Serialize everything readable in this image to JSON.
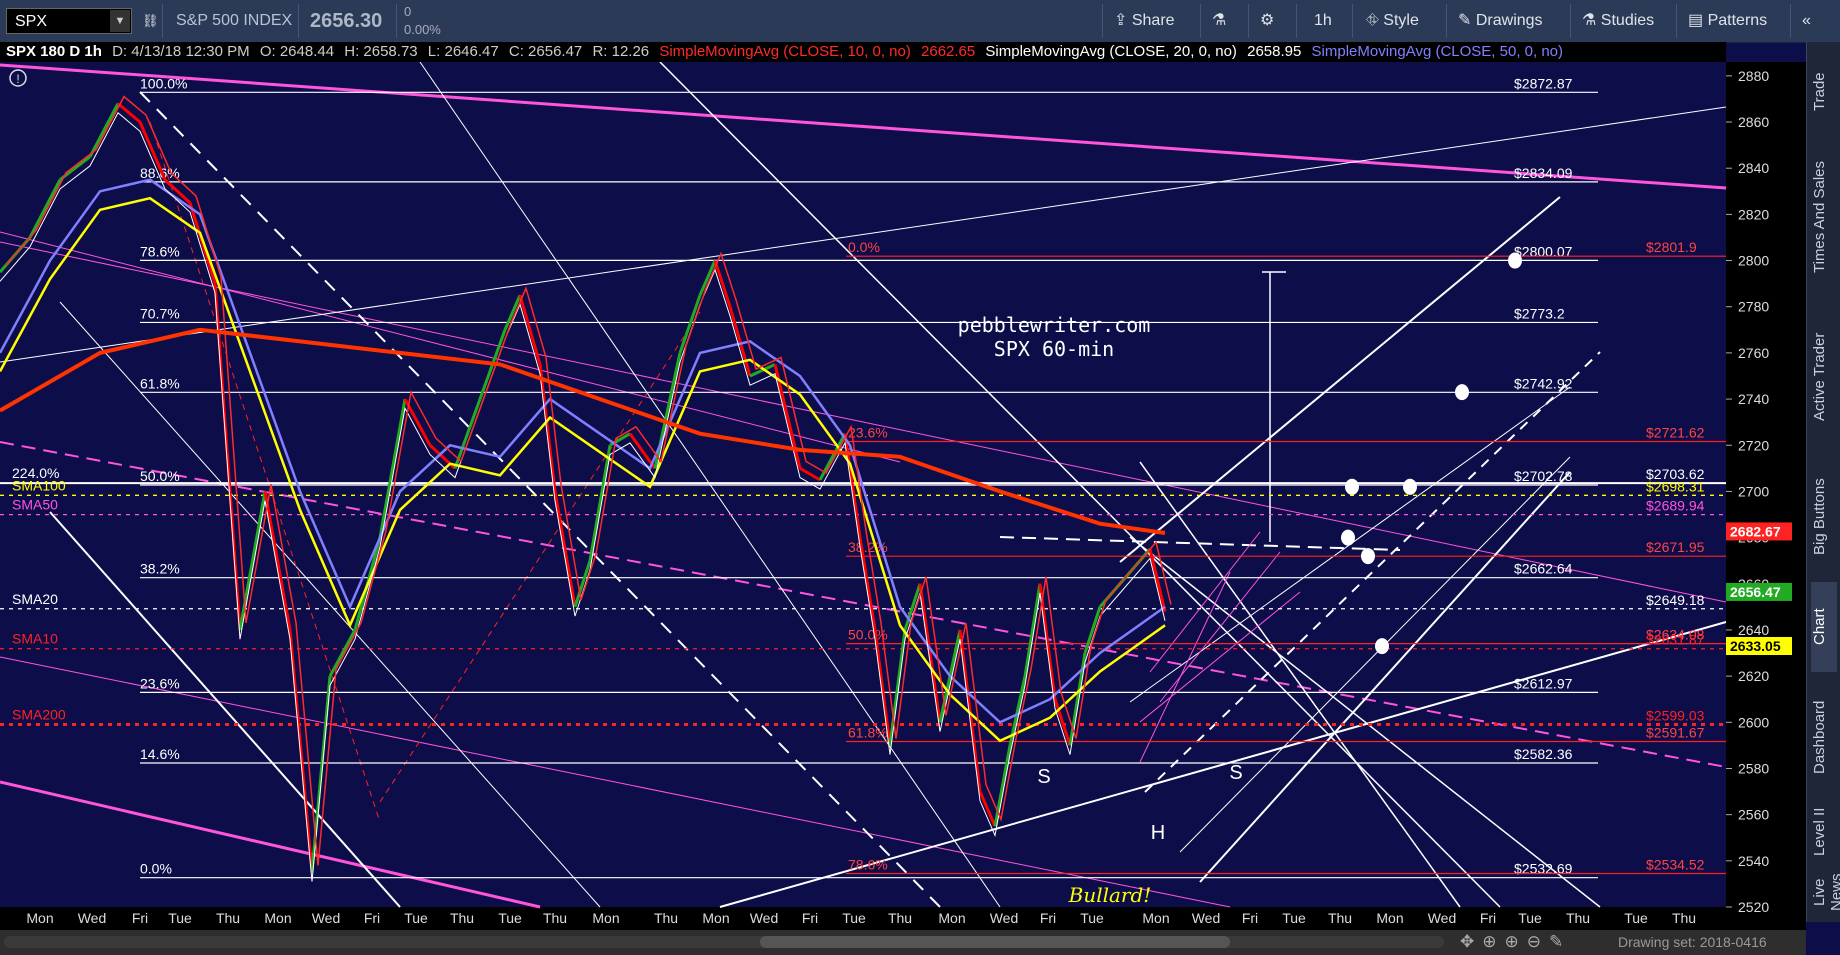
{
  "toolbar": {
    "symbol": "SPX",
    "name": "S&P 500 INDEX",
    "last": "2656.30",
    "change": "0",
    "change_pct": "0.00%",
    "share": "Share",
    "interval": "1h",
    "style": "Style",
    "drawings": "Drawings",
    "studies": "Studies",
    "patterns": "Patterns"
  },
  "infobar": {
    "title": "SPX 180 D 1h",
    "date": "D: 4/13/18 12:30 PM",
    "open": "O: 2648.44",
    "high": "H: 2658.73",
    "low": "L: 2646.47",
    "close": "C: 2656.47",
    "range": "R: 12.26",
    "sma10_label": "SimpleMovingAvg (CLOSE, 10, 0, no)",
    "sma10_val": "2662.65",
    "sma20_label": "SimpleMovingAvg (CLOSE, 20, 0, no)",
    "sma20_val": "2658.95",
    "sma50_label": "SimpleMovingAvg (CLOSE, 50, 0, no)"
  },
  "side_tabs": [
    "Trade",
    "Times And Sales",
    "Active Trader",
    "Big Buttons",
    "Chart",
    "Dashboard",
    "Level II",
    "Live News"
  ],
  "bottombar": {
    "drawing_set": "Drawing set: 2018-0416"
  },
  "colors": {
    "background": "#0d0d4a",
    "sma10": "#ff2a2a",
    "sma20": "#ffffff",
    "sma50": "#8080ff",
    "sma100": "#ffff00",
    "sma200": "#ff3300",
    "magenta": "#ff55dd",
    "fib": "#ffffff",
    "red_level": "#ff2222",
    "price_green": "#22aa22",
    "price_red": "#ff0000"
  },
  "chart_data": {
    "type": "line",
    "ylim": [
      2520,
      2886
    ],
    "yticks": [
      2520,
      2540,
      2560,
      2580,
      2600,
      2620,
      2640,
      2660,
      2680,
      2700,
      2720,
      2740,
      2760,
      2780,
      2800,
      2820,
      2840,
      2860,
      2880
    ],
    "xtick_labels": [
      "Mon",
      "Wed",
      "Fri",
      "Tue",
      "Thu",
      "Mon",
      "Wed",
      "Fri",
      "Tue",
      "Thu",
      "Tue",
      "Thu",
      "Mon",
      "Thu",
      "Mon",
      "Wed",
      "Fri",
      "Tue",
      "Thu",
      "Mon",
      "Wed",
      "Fri",
      "Tue",
      "Mon",
      "Wed",
      "Fri",
      "Tue",
      "Thu",
      "Mon",
      "Wed",
      "Fri",
      "Tue",
      "Thu",
      "Tue",
      "Thu"
    ],
    "price_path": [
      [
        0,
        2795
      ],
      [
        30,
        2810
      ],
      [
        60,
        2835
      ],
      [
        90,
        2845
      ],
      [
        118,
        2868
      ],
      [
        140,
        2860
      ],
      [
        165,
        2835
      ],
      [
        190,
        2825
      ],
      [
        215,
        2790
      ],
      [
        240,
        2640
      ],
      [
        265,
        2700
      ],
      [
        290,
        2640
      ],
      [
        312,
        2535
      ],
      [
        330,
        2620
      ],
      [
        355,
        2640
      ],
      [
        380,
        2680
      ],
      [
        405,
        2740
      ],
      [
        430,
        2720
      ],
      [
        455,
        2710
      ],
      [
        480,
        2740
      ],
      [
        505,
        2770
      ],
      [
        520,
        2785
      ],
      [
        540,
        2755
      ],
      [
        555,
        2700
      ],
      [
        575,
        2650
      ],
      [
        590,
        2670
      ],
      [
        610,
        2720
      ],
      [
        630,
        2725
      ],
      [
        655,
        2710
      ],
      [
        680,
        2760
      ],
      [
        700,
        2785
      ],
      [
        715,
        2800
      ],
      [
        730,
        2780
      ],
      [
        750,
        2750
      ],
      [
        775,
        2755
      ],
      [
        800,
        2710
      ],
      [
        820,
        2705
      ],
      [
        845,
        2725
      ],
      [
        860,
        2680
      ],
      [
        875,
        2640
      ],
      [
        890,
        2590
      ],
      [
        905,
        2640
      ],
      [
        920,
        2660
      ],
      [
        940,
        2600
      ],
      [
        960,
        2640
      ],
      [
        980,
        2570
      ],
      [
        995,
        2555
      ],
      [
        1010,
        2590
      ],
      [
        1025,
        2620
      ],
      [
        1040,
        2660
      ],
      [
        1055,
        2610
      ],
      [
        1070,
        2590
      ],
      [
        1085,
        2630
      ],
      [
        1100,
        2650
      ],
      [
        1120,
        2660
      ],
      [
        1140,
        2670
      ],
      [
        1150,
        2675
      ],
      [
        1165,
        2648
      ]
    ],
    "sma_path": [
      [
        0,
        2760
      ],
      [
        50,
        2800
      ],
      [
        100,
        2830
      ],
      [
        150,
        2835
      ],
      [
        200,
        2820
      ],
      [
        250,
        2760
      ],
      [
        300,
        2700
      ],
      [
        350,
        2650
      ],
      [
        400,
        2700
      ],
      [
        450,
        2720
      ],
      [
        500,
        2715
      ],
      [
        550,
        2740
      ],
      [
        600,
        2725
      ],
      [
        650,
        2710
      ],
      [
        700,
        2760
      ],
      [
        750,
        2765
      ],
      [
        800,
        2750
      ],
      [
        850,
        2720
      ],
      [
        900,
        2650
      ],
      [
        950,
        2620
      ],
      [
        1000,
        2600
      ],
      [
        1050,
        2610
      ],
      [
        1100,
        2630
      ],
      [
        1165,
        2650
      ]
    ],
    "sma200_path": [
      [
        0,
        2735
      ],
      [
        100,
        2760
      ],
      [
        200,
        2770
      ],
      [
        300,
        2765
      ],
      [
        400,
        2760
      ],
      [
        500,
        2755
      ],
      [
        600,
        2740
      ],
      [
        700,
        2725
      ],
      [
        800,
        2718
      ],
      [
        900,
        2715
      ],
      [
        1000,
        2700
      ],
      [
        1100,
        2686
      ],
      [
        1165,
        2682
      ]
    ],
    "fib_levels": [
      {
        "pct": "100.0%",
        "value": 2872.87,
        "label": "$2872.87"
      },
      {
        "pct": "88.6%",
        "value": 2834.09,
        "label": "$2834.09"
      },
      {
        "pct": "78.6%",
        "value": 2800.07,
        "label": "$2800.07"
      },
      {
        "pct": "70.7%",
        "value": 2773.2,
        "label": "$2773.2"
      },
      {
        "pct": "61.8%",
        "value": 2742.92,
        "label": "$2742.92"
      },
      {
        "pct": "50.0%",
        "value": 2702.78,
        "label": "$2702.78"
      },
      {
        "pct": "38.2%",
        "value": 2662.64,
        "label": "$2662.64"
      },
      {
        "pct": "23.6%",
        "value": 2612.97,
        "label": "$2612.97"
      },
      {
        "pct": "14.6%",
        "value": 2582.36,
        "label": "$2582.36"
      },
      {
        "pct": "0.0%",
        "value": 2532.69,
        "label": "$2532.69"
      }
    ],
    "red_fib_levels": [
      {
        "pct": "0.0%",
        "value": 2801.9,
        "label": "$2801.9"
      },
      {
        "pct": "23.6%",
        "value": 2721.62,
        "label": "$2721.62"
      },
      {
        "pct": "38.2%",
        "value": 2671.95,
        "label": "$2671.95"
      },
      {
        "pct": "50.0%",
        "value": 2634.08,
        "label": "$2634.08"
      },
      {
        "pct": "61.8%",
        "value": 2591.67,
        "label": "$2591.67"
      },
      {
        "pct": "78.6%",
        "value": 2534.52,
        "label": "$2534.52"
      }
    ],
    "left_labels": [
      {
        "text": "224.0%",
        "value": 2703.62,
        "color": "#ffffff"
      },
      {
        "text": "SMA100",
        "value": 2698.31,
        "color": "#ffff00"
      },
      {
        "text": "SMA50",
        "value": 2689.94,
        "color": "#ff55dd"
      },
      {
        "text": "SMA20",
        "value": 2649.18,
        "color": "#ffffff"
      },
      {
        "text": "SMA10",
        "value": 2631.87,
        "color": "#ff2222"
      },
      {
        "text": "SMA200",
        "value": 2599.03,
        "color": "#ff2222"
      }
    ],
    "right_values": [
      {
        "text": "$2703.62",
        "value": 2703.62,
        "color": "#ffffff"
      },
      {
        "text": "$2698.31",
        "value": 2698.31,
        "color": "#ffff00"
      },
      {
        "text": "$2689.94",
        "value": 2689.94,
        "color": "#ff55dd"
      },
      {
        "text": "$2649.18",
        "value": 2649.18,
        "color": "#ffffff"
      },
      {
        "text": "$2631.87",
        "value": 2631.87,
        "color": "#ff2222"
      },
      {
        "text": "$2599.03",
        "value": 2599.03,
        "color": "#ff2222"
      }
    ],
    "price_tags": [
      {
        "text": "2682.67",
        "value": 2682.67,
        "bg": "#ff2222",
        "fg": "#ffffff"
      },
      {
        "text": "2656.47",
        "value": 2656.47,
        "bg": "#22aa22",
        "fg": "#ffffff"
      },
      {
        "text": "2633.05",
        "value": 2633.05,
        "bg": "#ffff00",
        "fg": "#000000"
      }
    ],
    "annotations": [
      {
        "text": "pebblewriter.com",
        "color": "#ffffff"
      },
      {
        "text": "SPX 60-min",
        "color": "#ffffff"
      },
      {
        "text": "S",
        "color": "#ffffff"
      },
      {
        "text": "S",
        "color": "#ffffff"
      },
      {
        "text": "H",
        "color": "#ffffff"
      },
      {
        "text": "Bullard!",
        "color": "#ffff00"
      }
    ]
  }
}
